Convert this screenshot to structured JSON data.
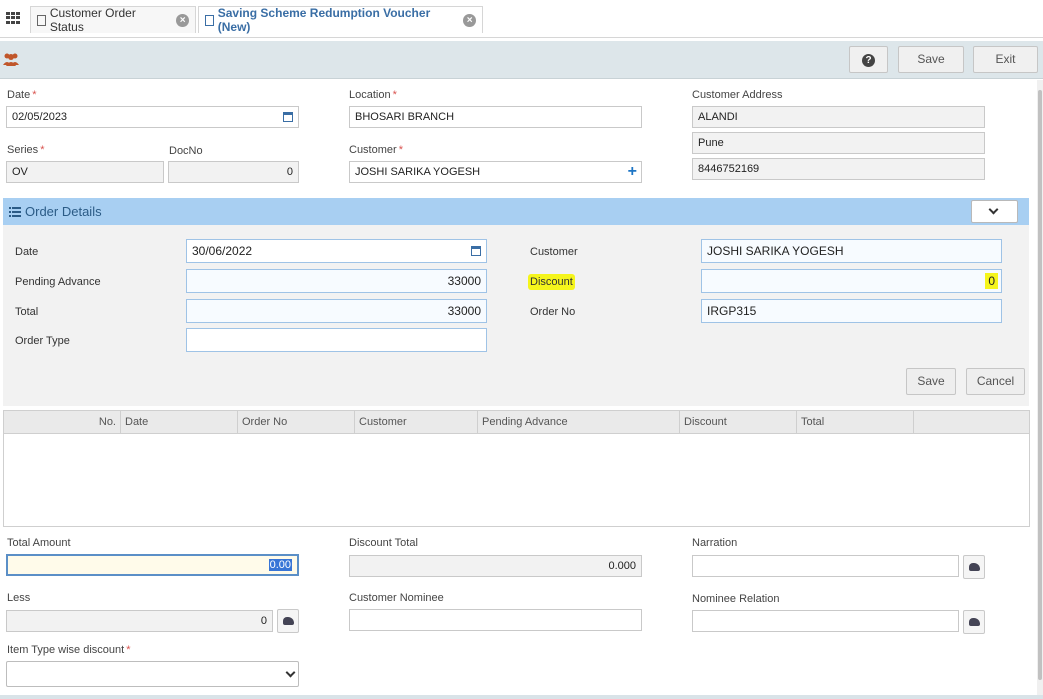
{
  "tabs": [
    {
      "label": "Customer Order Status"
    },
    {
      "label": "Saving Scheme Redumption Voucher (New)"
    }
  ],
  "toolbar": {
    "save_label": "Save",
    "exit_label": "Exit",
    "help_symbol": "?"
  },
  "header": {
    "date_label": "Date",
    "date_value": "02/05/2023",
    "location_label": "Location",
    "location_value": "BHOSARI BRANCH",
    "address_label": "Customer Address",
    "address_line1": "ALANDI",
    "address_line2": "Pune",
    "address_phone": "8446752169",
    "series_label": "Series",
    "series_value": "OV",
    "docno_label": "DocNo",
    "docno_value": "0",
    "customer_label": "Customer",
    "customer_value": "JOSHI SARIKA  YOGESH",
    "required_mark": "*"
  },
  "order_details": {
    "title": "Order Details",
    "date_label": "Date",
    "date_value": "30/06/2022",
    "pending_label": "Pending Advance",
    "pending_value": "33000",
    "total_label": "Total",
    "total_value": "33000",
    "order_type_label": "Order Type",
    "order_type_value": "",
    "customer_label": "Customer",
    "customer_value": "JOSHI SARIKA  YOGESH",
    "discount_label": "Discount",
    "discount_value": "0",
    "order_no_label": "Order No",
    "order_no_value": "IRGP315",
    "save_label": "Save",
    "cancel_label": "Cancel"
  },
  "grid": {
    "columns": [
      "No.",
      "Date",
      "Order No",
      "Customer",
      "Pending Advance",
      "Discount",
      "Total"
    ]
  },
  "footer": {
    "total_amount_label": "Total Amount",
    "total_amount_value": "0.00",
    "discount_total_label": "Discount Total",
    "discount_total_value": "0.000",
    "narration_label": "Narration",
    "narration_value": "",
    "less_label": "Less",
    "less_value": "0",
    "nominee_label": "Customer Nominee",
    "nominee_value": "",
    "nominee_relation_label": "Nominee Relation",
    "nominee_relation_value": "",
    "item_discount_label": "Item Type wise discount",
    "item_discount_value": ""
  },
  "icons": [
    "apps-grid-icon",
    "document-icon",
    "close-icon",
    "people-icon",
    "help-icon",
    "calendar-icon",
    "plus-icon",
    "list-icon",
    "chevron-down-icon",
    "lookup-icon"
  ],
  "colors": {
    "accent": "#3a6ea5",
    "panel_header": "#a8cff2",
    "highlight": "#f5f51c",
    "required": "#d9534f"
  }
}
